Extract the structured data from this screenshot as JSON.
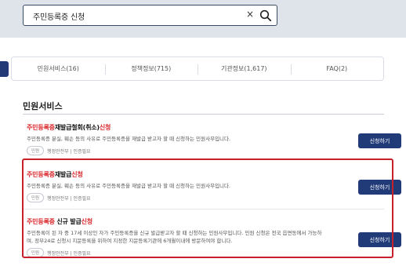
{
  "search": {
    "query": "주민등록증 신청",
    "clear_glyph": "×"
  },
  "tabs": [
    {
      "label": "민원서비스(16)"
    },
    {
      "label": "정책정보(715)"
    },
    {
      "label": "기관정보(1,617)"
    },
    {
      "label": "FAQ(2)"
    }
  ],
  "section": {
    "title": "민원서비스"
  },
  "items": [
    {
      "title_pre": "주민등록증",
      "title_post": "재발급철회(취소)",
      "title_tail": "신청",
      "desc": "주민등록증 분실, 훼손 등의 사유로 주민등록증을 재발급 받고자 할 때 신청하는 민원사무입니다.",
      "badge": "민원",
      "meta": "행정안전부 | 인증필요",
      "button": "신청하기"
    },
    {
      "title_pre": "주민등록증",
      "title_post": "재발급",
      "title_tail": "신청",
      "desc": "주민등록증 분실, 훼손 등의 사유로 주민등록증을 재발급 받고자 할 때 신청하는 민원사무입니다.",
      "badge": "민원",
      "meta": "행정안전부 | 인증필요",
      "button": "신청하기"
    },
    {
      "title_pre": "주민등록증",
      "title_post": " 신규 발급",
      "title_tail": "신청",
      "desc": "주민등록이 된 자 중 17세 이상인 자가 주민등록증을 신규 발급받고자 할 때 신청하는 민원사무입니다. 민원 신청은 전국 읍면동에서 가능하며, 정부24로 신청시 지문등록을 위하여 지정한 지문등록기관에 6개월이내에 방문하여야 합니다.",
      "badge": "민원",
      "meta": "행정안전부 | 인증필요",
      "button": "신청하기"
    }
  ]
}
